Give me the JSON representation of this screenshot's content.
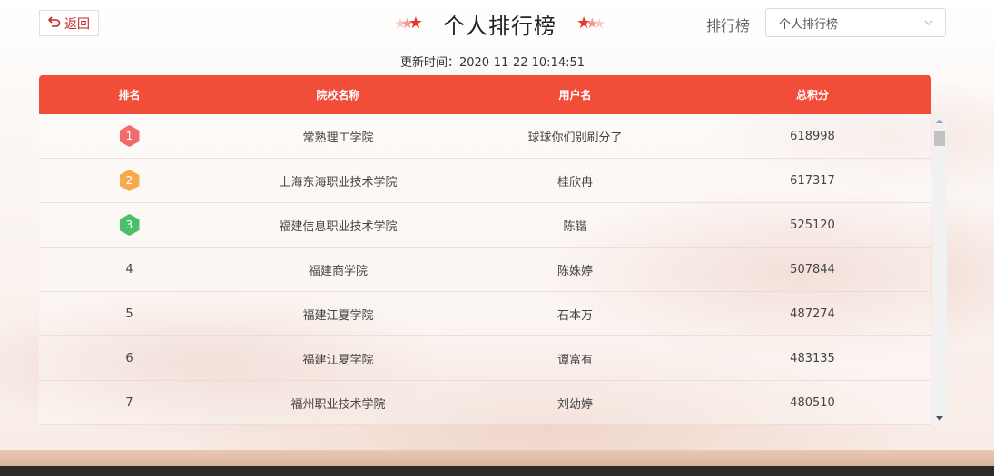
{
  "header": {
    "back_label": "返回",
    "title": "个人排行榜",
    "filter_label": "排行榜",
    "filter_selected": "个人排行榜",
    "update_time": "更新时间：2020-11-22 10:14:51"
  },
  "colors": {
    "accent": "#f24d38",
    "back_text": "#c4262e",
    "star": "#e8392e",
    "rank1": "#f26b6b",
    "rank2": "#f7a94b",
    "rank3": "#4cbf6a"
  },
  "icons": {
    "back": "return-arrow-icon",
    "stars": "star-icon",
    "select": "chevron-down-icon"
  },
  "table": {
    "columns": [
      "排名",
      "院校名称",
      "用户名",
      "总积分"
    ],
    "rows": [
      {
        "rank": "1",
        "school": "常熟理工学院",
        "user": "球球你们别刷分了",
        "score": "618998",
        "badge_color": "#f26b6b"
      },
      {
        "rank": "2",
        "school": "上海东海职业技术学院",
        "user": "桂欣冉",
        "score": "617317",
        "badge_color": "#f7a94b"
      },
      {
        "rank": "3",
        "school": "福建信息职业技术学院",
        "user": "陈锴",
        "score": "525120",
        "badge_color": "#4cbf6a"
      },
      {
        "rank": "4",
        "school": "福建商学院",
        "user": "陈姝婷",
        "score": "507844",
        "badge_color": ""
      },
      {
        "rank": "5",
        "school": "福建江夏学院",
        "user": "石本万",
        "score": "487274",
        "badge_color": ""
      },
      {
        "rank": "6",
        "school": "福建江夏学院",
        "user": "谭富有",
        "score": "483135",
        "badge_color": ""
      },
      {
        "rank": "7",
        "school": "福州职业技术学院",
        "user": "刘幼婷",
        "score": "480510",
        "badge_color": ""
      }
    ]
  }
}
